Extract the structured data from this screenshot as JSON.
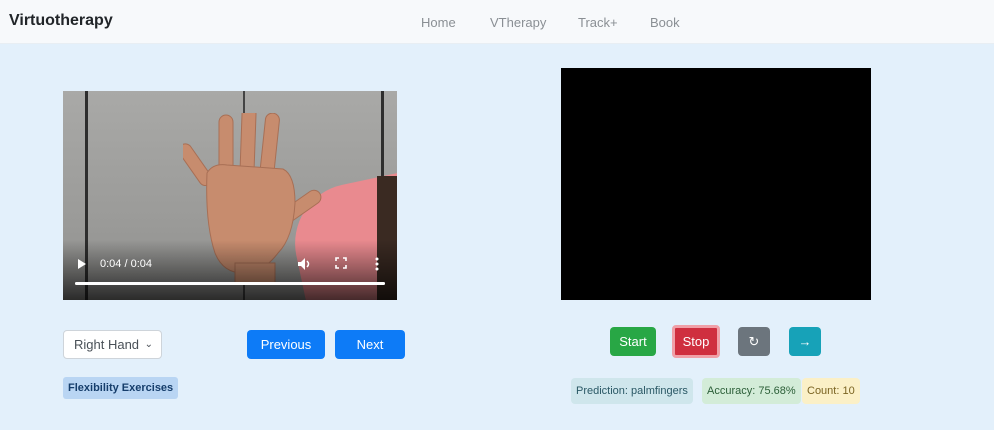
{
  "navbar": {
    "brand": "Virtuotherapy",
    "links": [
      {
        "label": "Home"
      },
      {
        "label": "VTherapy"
      },
      {
        "label": "Track+"
      },
      {
        "label": "Book"
      }
    ]
  },
  "video": {
    "time": "0:04 / 0:04",
    "progress": 1.0,
    "play_icon": "play-icon",
    "volume_icon": "volume-icon",
    "fullscreen_icon": "fullscreen-icon",
    "more_icon": "more-vertical-icon"
  },
  "left_controls": {
    "hand_select_value": "Right Hand",
    "previous_label": "Previous",
    "next_label": "Next",
    "category_badge": "Flexibility Exercises"
  },
  "camera_controls": {
    "start_label": "Start",
    "stop_label": "Stop",
    "reset_icon": "refresh-icon",
    "next_icon": "arrow-right-icon",
    "reset_glyph": "↻",
    "next_glyph": "→"
  },
  "stats": {
    "prediction": "Prediction: palmfingers",
    "accuracy": "Accuracy: 75.68%",
    "count": "Count: 10"
  },
  "colors": {
    "primary": "#0d7bf7",
    "success": "#28a745",
    "danger": "#cf2f3f",
    "secondary": "#6c757d",
    "info": "#17a2b8",
    "page_bg": "#e3f0fb"
  }
}
